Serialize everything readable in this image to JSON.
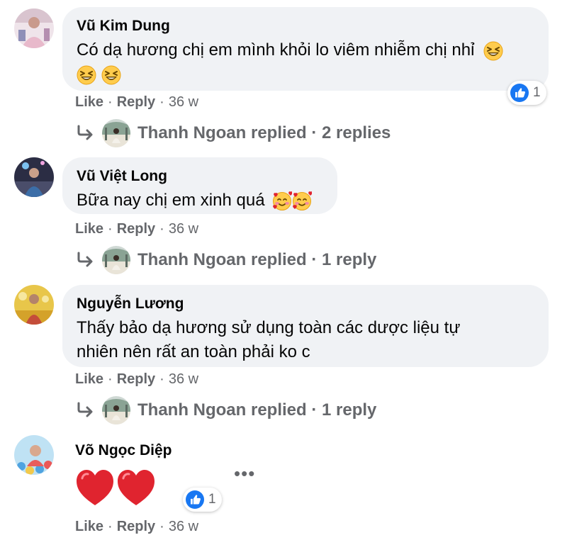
{
  "action_labels": {
    "like": "Like",
    "reply": "Reply",
    "separator": "·"
  },
  "comments": [
    {
      "author": "Vũ Kim Dung",
      "text": "Có dạ hương chị em mình khỏi lo viêm nhiễm chị nhỉ",
      "emoji": [
        "grinning-squinting-face",
        "grinning-squinting-face",
        "grinning-squinting-face"
      ],
      "time": "36 w",
      "reaction": {
        "icon": "like-icon",
        "count": "1"
      },
      "replies": {
        "text": "Thanh Ngoan replied · 2 replies"
      }
    },
    {
      "author": "Vũ Việt Long",
      "text": "Bữa nay chị em xinh quá",
      "emoji": [
        "smiling-face-with-hearts",
        "smiling-face-with-hearts"
      ],
      "time": "36 w",
      "replies": {
        "text": "Thanh Ngoan replied · 1 reply"
      }
    },
    {
      "author": "Nguyễn Lương",
      "text_line1": "Thấy bảo dạ hương sử dụng toàn các dược liệu tự",
      "text_line2": "nhiên nên rất an toàn phải ko c",
      "time": "36 w",
      "replies": {
        "text": "Thanh Ngoan replied · 1 reply"
      }
    },
    {
      "author": "Võ Ngọc Diệp",
      "emoji": [
        "red-heart",
        "red-heart"
      ],
      "time": "36 w",
      "reaction": {
        "icon": "like-icon",
        "count": "1"
      },
      "more": "•••"
    }
  ],
  "colors": {
    "bubble": "#f0f2f5",
    "secondary_text": "#65676b",
    "like_blue": "#1877f2",
    "heart_red": "#e0242f"
  }
}
